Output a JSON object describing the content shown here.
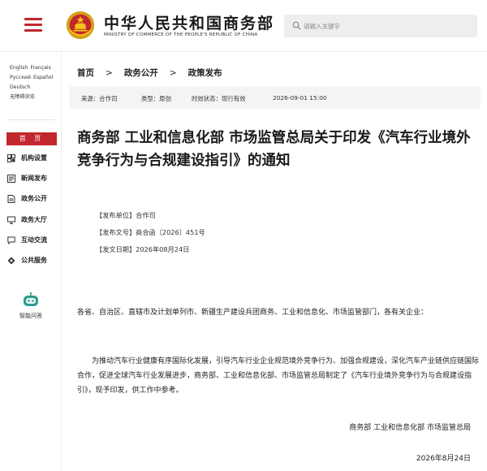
{
  "header": {
    "site_name_cn": "中华人民共和国商务部",
    "site_name_en": "MINISTRY OF COMMERCE OF THE PEOPLE'S REPUBLIC OF CHINA",
    "search_placeholder": "请输入关键字",
    "menu_icon": "hamburger-icon",
    "emblem_icon": "national-emblem-icon",
    "search_icon": "search-icon",
    "accent_color": "#c1272d"
  },
  "sidebar": {
    "languages": [
      "English",
      "Français",
      "Русский",
      "Español",
      "Deutsch",
      "无障碍浏览"
    ],
    "home_label": "首 页",
    "items": [
      {
        "label": "机构设置",
        "icon": "org-chart-icon"
      },
      {
        "label": "新闻发布",
        "icon": "news-icon"
      },
      {
        "label": "政务公开",
        "icon": "document-icon"
      },
      {
        "label": "政务大厅",
        "icon": "hall-icon"
      },
      {
        "label": "互动交流",
        "icon": "chat-icon"
      },
      {
        "label": "公共服务",
        "icon": "service-icon"
      }
    ],
    "assistant_label": "智能问答",
    "assistant_icon": "robot-icon"
  },
  "breadcrumb": {
    "items": [
      "首页",
      "政务公开",
      "政策发布"
    ],
    "separator": ">"
  },
  "meta": {
    "source": "来源：合作司",
    "type": "类型：原创",
    "status": "时效状态：现行有效",
    "datetime": "2026-09-01 15:00"
  },
  "article": {
    "title": "商务部 工业和信息化部 市场监管总局关于印发《汽车行业境外竞争行为与合规建设指引》的通知",
    "publisher": "【发布单位】合作司",
    "doc_number": "【发布文号】商合函〔2026〕451号",
    "issue_date": "【发文日期】2026年08月24日",
    "addressee": "各省、自治区、直辖市及计划单列市、新疆生产建设兵团商务、工业和信息化、市场监管部门，各有关企业：",
    "body": "为推动汽车行业健康有序国际化发展，引导汽车行业企业规范境外竞争行为、加强合规建设，深化汽车产业链供应链国际合作，促进全球汽车行业发展进步，商务部、工业和信息化部、市场监管总局制定了《汽车行业境外竞争行为与合规建设指引》，现予印发，供工作中参考。",
    "signatories": "商务部  工业和信息化部  市场监管总局",
    "sign_date": "2026年8月24日"
  }
}
